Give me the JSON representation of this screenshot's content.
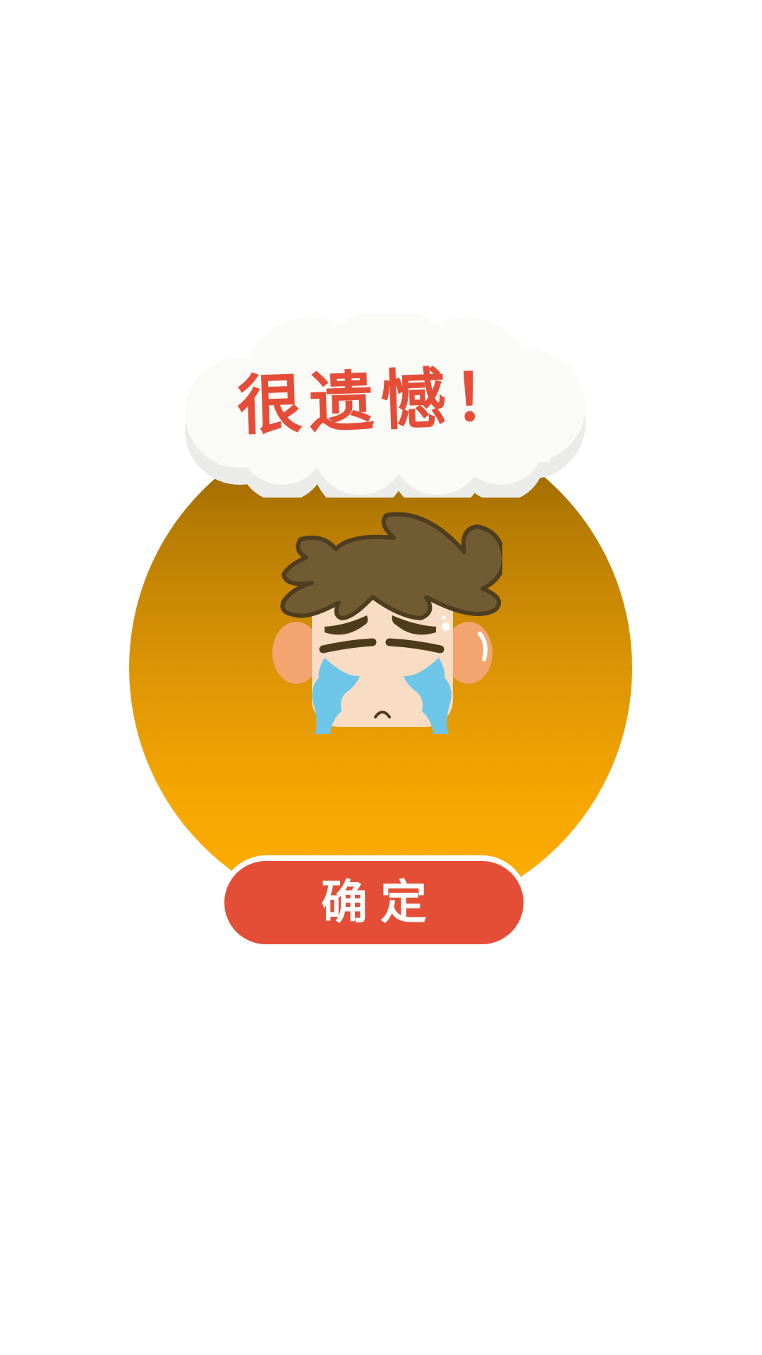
{
  "dialog": {
    "title": "很遗憾！",
    "confirm_label": "确定"
  },
  "icons": {
    "character": "crying-boy-icon",
    "cloud": "cloud-bubble-icon"
  },
  "colors": {
    "title_text": "#e54d38",
    "button_bg": "#e44e37",
    "orb_top": "#8a5c00",
    "orb_bottom": "#ffae00",
    "cloud": "#fafbf7"
  }
}
